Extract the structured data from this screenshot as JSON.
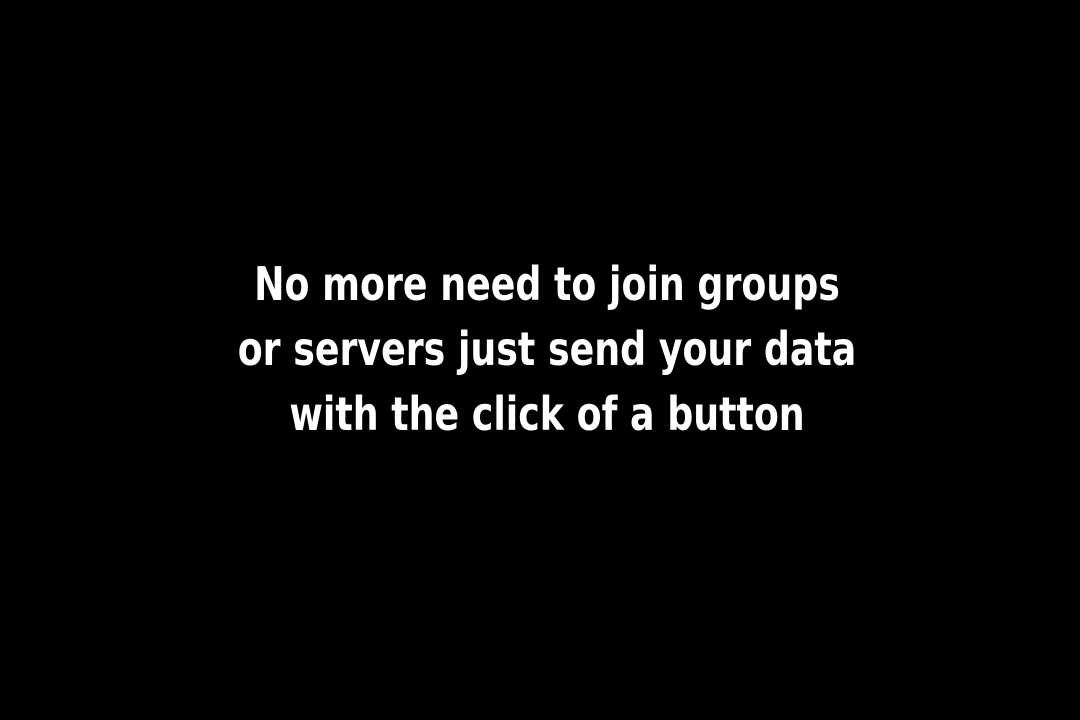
{
  "background_color": "#000000",
  "text_color": "#ffffff",
  "caption": {
    "lines": [
      "No more need to join groups",
      "or servers just send your data",
      "with the click of a button"
    ]
  }
}
